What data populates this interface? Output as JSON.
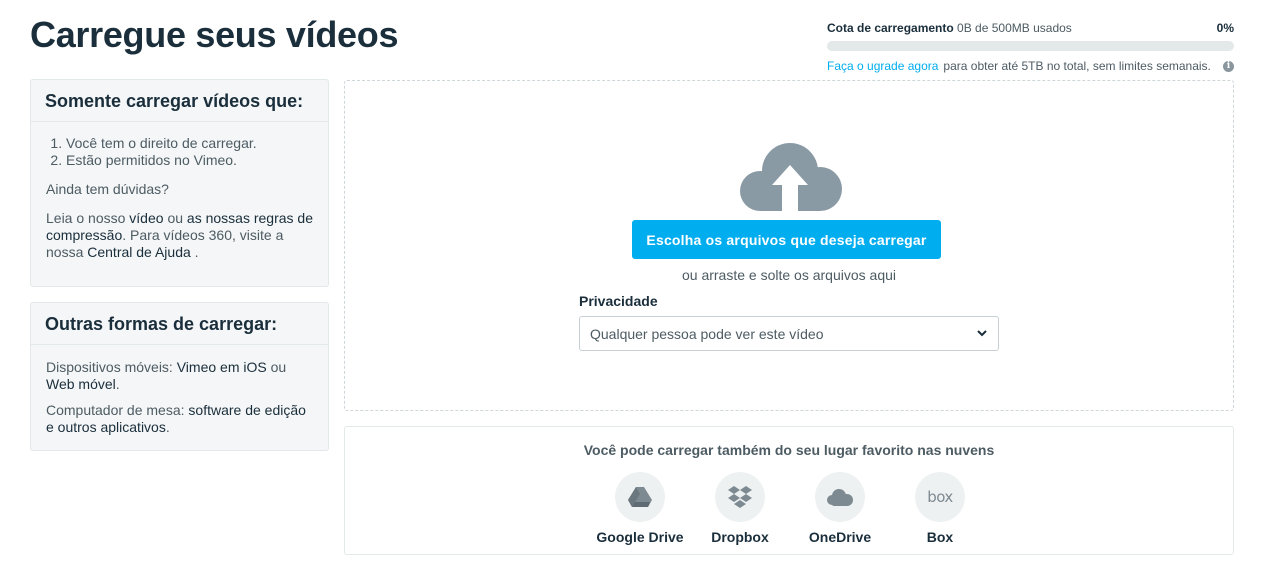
{
  "page_title": "Carregue seus vídeos",
  "quota": {
    "label": "Cota de carregamento",
    "usage": "0B de 500MB usados",
    "percent_text": "0%",
    "fill_fraction": 0,
    "upgrade_link": "Faça o ugrade agora",
    "upgrade_text": "para obter até 5TB no total, sem limites semanais.",
    "info_icon": "info-icon"
  },
  "rules_box": {
    "title": "Somente carregar vídeos que:",
    "items": [
      "Você tem o direito de carregar.",
      "Estão permitidos no Vimeo."
    ],
    "doubts": "Ainda tem dúvidas?",
    "read_prefix": "Leia o nosso",
    "video_link": "vídeo",
    "or_text": "ou",
    "rules_link": "as nossas regras de compressão",
    "mid_text": ". Para vídeos 360, visite a nossa",
    "help_link": "Central de Ajuda",
    "end_text": "."
  },
  "other_box": {
    "title": "Outras formas de carregar:",
    "mobile_prefix": "Dispositivos móveis:",
    "ios_link": "Vimeo em iOS",
    "or_text": "ou",
    "web_link": "Web móvel",
    "mobile_end": ".",
    "desktop_prefix": "Computador de mesa:",
    "desktop_link": "software de edição e outros aplicativos",
    "desktop_end": "."
  },
  "upload": {
    "icon": "cloud-upload-icon",
    "button": "Escolha os arquivos que deseja carregar",
    "drag_hint": "ou arraste e solte os arquivos aqui",
    "privacy_label": "Privacidade",
    "privacy_value": "Qualquer pessoa pode ver este vídeo"
  },
  "cloud_services": {
    "title": "Você pode carregar também do seu lugar favorito nas nuvens",
    "services": [
      {
        "label": "Google Drive",
        "icon": "google-drive-icon"
      },
      {
        "label": "Dropbox",
        "icon": "dropbox-icon"
      },
      {
        "label": "OneDrive",
        "icon": "onedrive-icon"
      },
      {
        "label": "Box",
        "icon": "box-icon",
        "logo_text": "box"
      }
    ]
  },
  "colors": {
    "accent": "#00adef",
    "heading": "#1a2e3b",
    "icon_gray": "#8a9aa4",
    "panel_bg": "#f4f6f7"
  }
}
